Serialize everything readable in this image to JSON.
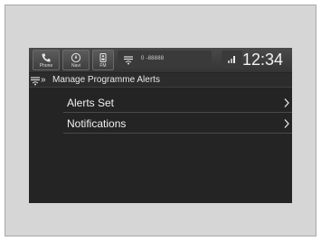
{
  "status_bar": {
    "phone_label": "Phone",
    "navi_label": "Navi",
    "fm_label": "FM",
    "radio_info": "0 -88888",
    "clock": "12:34"
  },
  "breadcrumb": {
    "separator": "»",
    "title": "Manage Programme Alerts"
  },
  "menu": {
    "items": [
      {
        "label": "Alerts Set"
      },
      {
        "label": "Notifications"
      }
    ]
  },
  "icons": {
    "phone": "phone-icon",
    "navi": "navigation-compass-icon",
    "fm": "fm-radio-icon",
    "radio_signal": "radio-signal-icon",
    "signal": "signal-strength-icon",
    "breadcrumb": "radio-signal-icon",
    "chevron": "chevron-right-icon"
  },
  "colors": {
    "screen_bg": "#242424",
    "text": "#f0f0f0",
    "bezel": "#d6d6d6"
  }
}
